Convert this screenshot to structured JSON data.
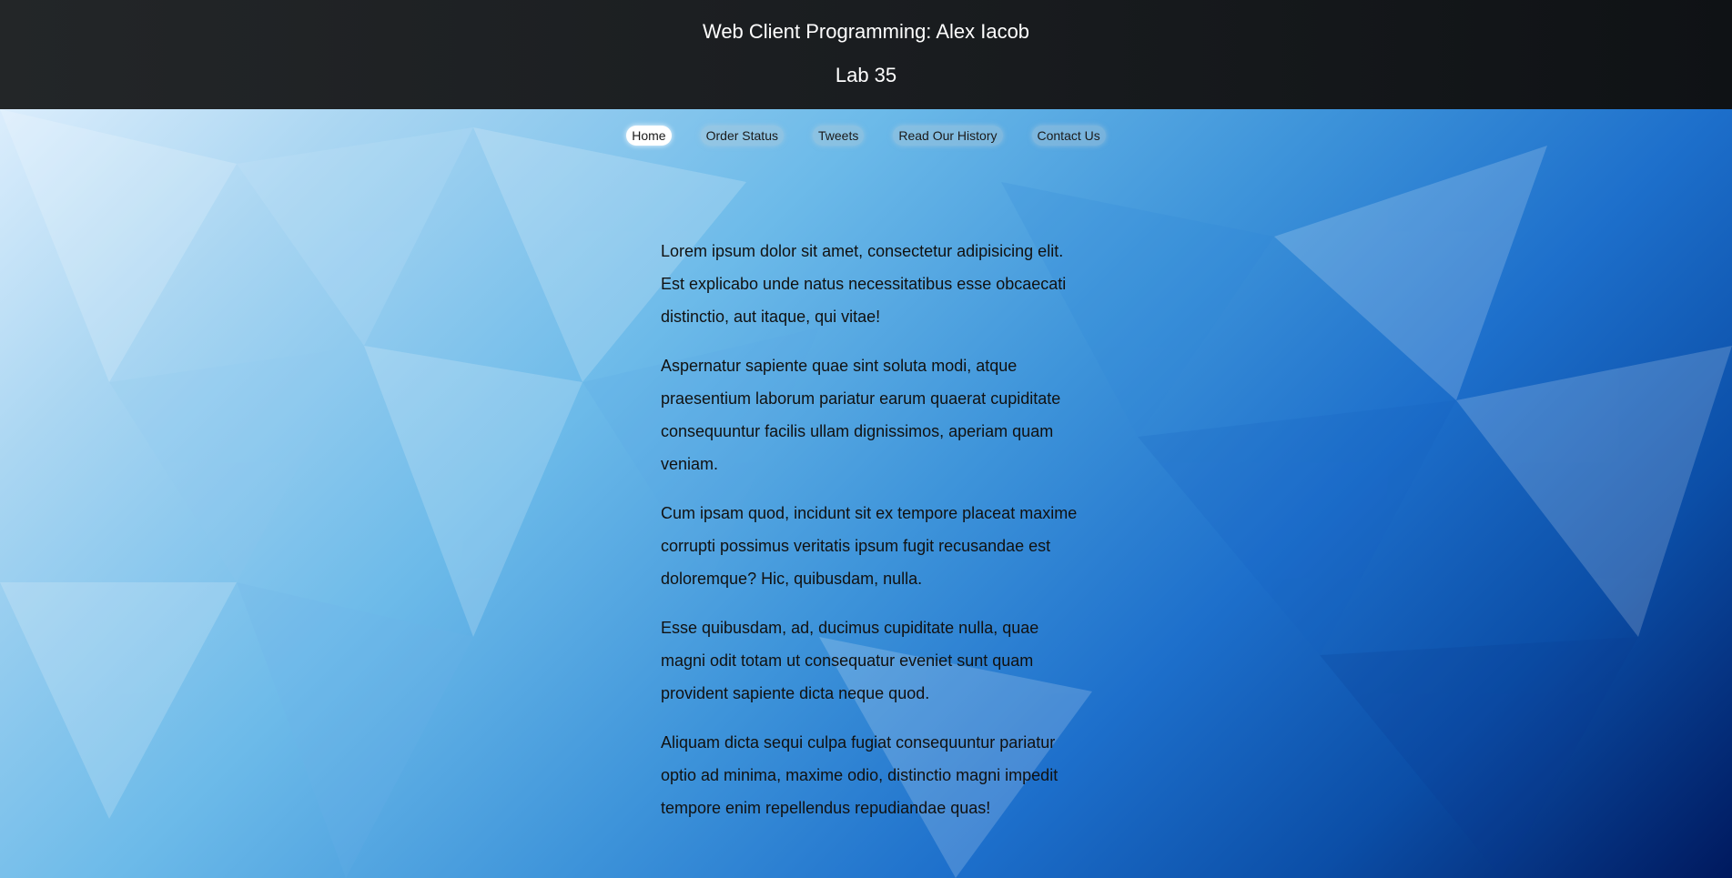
{
  "header": {
    "title": "Web Client Programming: Alex Iacob",
    "subtitle": "Lab 35"
  },
  "nav": {
    "items": [
      {
        "label": "Home",
        "active": true
      },
      {
        "label": "Order Status",
        "active": false
      },
      {
        "label": "Tweets",
        "active": false
      },
      {
        "label": "Read Our History",
        "active": false
      },
      {
        "label": "Contact Us",
        "active": false
      }
    ]
  },
  "content": {
    "paragraphs": [
      "Lorem ipsum dolor sit amet, consectetur adipisicing elit. Est explicabo unde natus necessitatibus esse obcaecati distinctio, aut itaque, qui vitae!",
      "Aspernatur sapiente quae sint soluta modi, atque praesentium laborum pariatur earum quaerat cupiditate consequuntur facilis ullam dignissimos, aperiam quam veniam.",
      "Cum ipsam quod, incidunt sit ex tempore placeat maxime corrupti possimus veritatis ipsum fugit recusandae est doloremque? Hic, quibusdam, nulla.",
      "Esse quibusdam, ad, ducimus cupiditate nulla, quae magni odit totam ut consequatur eveniet sunt quam provident sapiente dicta neque quod.",
      "Aliquam dicta sequi culpa fugiat consequuntur pariatur optio ad minima, maxime odio, distinctio magni impedit tempore enim repellendus repudiandae quas!"
    ]
  },
  "colors": {
    "header_bg": "#1a1d20",
    "header_text": "#ffffff",
    "nav_active_bg": "#ffffff",
    "body_text": "#111111",
    "background_light": "#eaf4ff",
    "background_dark": "#00195e"
  }
}
